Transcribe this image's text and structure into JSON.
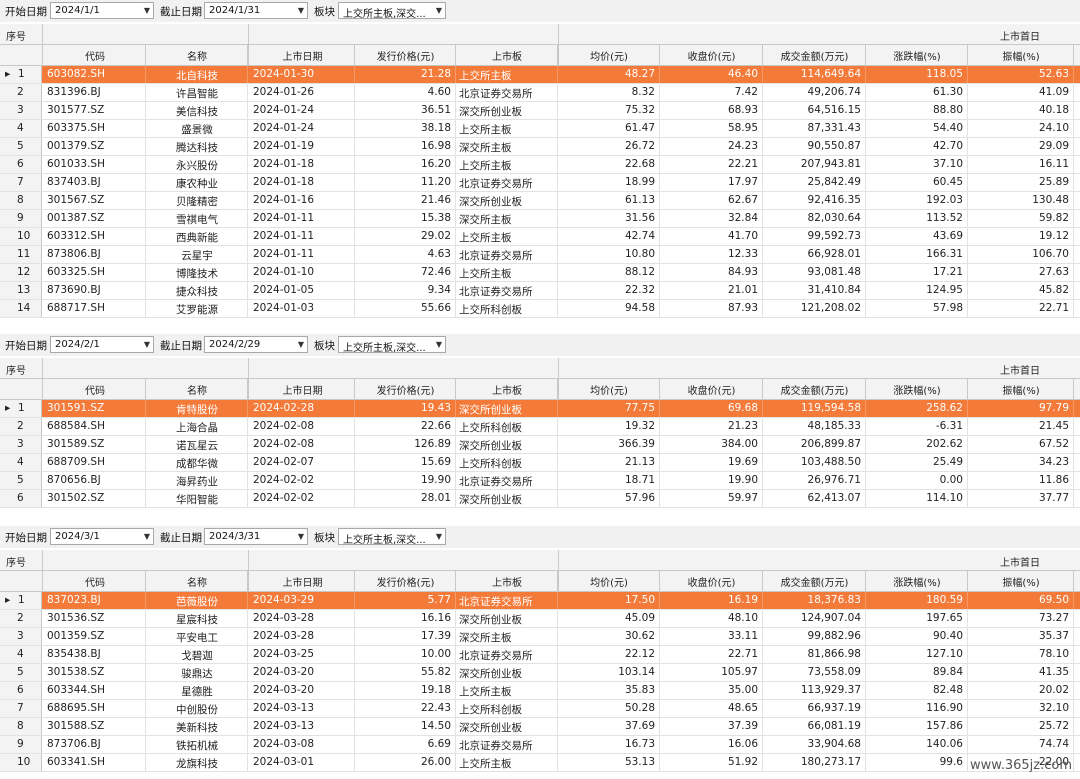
{
  "labels": {
    "start_date": "开始日期",
    "end_date": "截止日期",
    "board": "板块",
    "seq": "序号",
    "first_day": "上市首日",
    "columns": [
      "代码",
      "名称",
      "上市日期",
      "发行价格(元)",
      "上市板",
      "均价(元)",
      "收盘价(元)",
      "成交金额(万元)",
      "涨跌幅(%)",
      "振幅(%)"
    ]
  },
  "sections": [
    {
      "start": "2024/1/1",
      "end": "2024/1/31",
      "board": "上交所主板,深交...",
      "rows": [
        [
          "1",
          "603082.SH",
          "北自科技",
          "2024-01-30",
          "21.28",
          "上交所主板",
          "48.27",
          "46.40",
          "114,649.64",
          "118.05",
          "52.63"
        ],
        [
          "2",
          "831396.BJ",
          "许昌智能",
          "2024-01-26",
          "4.60",
          "北京证券交易所",
          "8.32",
          "7.42",
          "49,206.74",
          "61.30",
          "41.09"
        ],
        [
          "3",
          "301577.SZ",
          "美信科技",
          "2024-01-24",
          "36.51",
          "深交所创业板",
          "75.32",
          "68.93",
          "64,516.15",
          "88.80",
          "40.18"
        ],
        [
          "4",
          "603375.SH",
          "盛景微",
          "2024-01-24",
          "38.18",
          "上交所主板",
          "61.47",
          "58.95",
          "87,331.43",
          "54.40",
          "24.10"
        ],
        [
          "5",
          "001379.SZ",
          "腾达科技",
          "2024-01-19",
          "16.98",
          "深交所主板",
          "26.72",
          "24.23",
          "90,550.87",
          "42.70",
          "29.09"
        ],
        [
          "6",
          "601033.SH",
          "永兴股份",
          "2024-01-18",
          "16.20",
          "上交所主板",
          "22.68",
          "22.21",
          "207,943.81",
          "37.10",
          "16.11"
        ],
        [
          "7",
          "837403.BJ",
          "康农种业",
          "2024-01-18",
          "11.20",
          "北京证券交易所",
          "18.99",
          "17.97",
          "25,842.49",
          "60.45",
          "25.89"
        ],
        [
          "8",
          "301567.SZ",
          "贝隆精密",
          "2024-01-16",
          "21.46",
          "深交所创业板",
          "61.13",
          "62.67",
          "92,416.35",
          "192.03",
          "130.48"
        ],
        [
          "9",
          "001387.SZ",
          "雪祺电气",
          "2024-01-11",
          "15.38",
          "深交所主板",
          "31.56",
          "32.84",
          "82,030.64",
          "113.52",
          "59.82"
        ],
        [
          "10",
          "603312.SH",
          "西典新能",
          "2024-01-11",
          "29.02",
          "上交所主板",
          "42.74",
          "41.70",
          "99,592.73",
          "43.69",
          "19.12"
        ],
        [
          "11",
          "873806.BJ",
          "云星宇",
          "2024-01-11",
          "4.63",
          "北京证券交易所",
          "10.80",
          "12.33",
          "66,928.01",
          "166.31",
          "106.70"
        ],
        [
          "12",
          "603325.SH",
          "博隆技术",
          "2024-01-10",
          "72.46",
          "上交所主板",
          "88.12",
          "84.93",
          "93,081.48",
          "17.21",
          "27.63"
        ],
        [
          "13",
          "873690.BJ",
          "捷众科技",
          "2024-01-05",
          "9.34",
          "北京证券交易所",
          "22.32",
          "21.01",
          "31,410.84",
          "124.95",
          "45.82"
        ],
        [
          "14",
          "688717.SH",
          "艾罗能源",
          "2024-01-03",
          "55.66",
          "上交所科创板",
          "94.58",
          "87.93",
          "121,208.02",
          "57.98",
          "22.71"
        ]
      ]
    },
    {
      "start": "2024/2/1",
      "end": "2024/2/29",
      "board": "上交所主板,深交...",
      "rows": [
        [
          "1",
          "301591.SZ",
          "肯特股份",
          "2024-02-28",
          "19.43",
          "深交所创业板",
          "77.75",
          "69.68",
          "119,594.58",
          "258.62",
          "97.79"
        ],
        [
          "2",
          "688584.SH",
          "上海合晶",
          "2024-02-08",
          "22.66",
          "上交所科创板",
          "19.32",
          "21.23",
          "48,185.33",
          "-6.31",
          "21.45"
        ],
        [
          "3",
          "301589.SZ",
          "诺瓦星云",
          "2024-02-08",
          "126.89",
          "深交所创业板",
          "366.39",
          "384.00",
          "206,899.87",
          "202.62",
          "67.52"
        ],
        [
          "4",
          "688709.SH",
          "成都华微",
          "2024-02-07",
          "15.69",
          "上交所科创板",
          "21.13",
          "19.69",
          "103,488.50",
          "25.49",
          "34.23"
        ],
        [
          "5",
          "870656.BJ",
          "海昇药业",
          "2024-02-02",
          "19.90",
          "北京证券交易所",
          "18.71",
          "19.90",
          "26,976.71",
          "0.00",
          "11.86"
        ],
        [
          "6",
          "301502.SZ",
          "华阳智能",
          "2024-02-02",
          "28.01",
          "深交所创业板",
          "57.96",
          "59.97",
          "62,413.07",
          "114.10",
          "37.77"
        ]
      ]
    },
    {
      "start": "2024/3/1",
      "end": "2024/3/31",
      "board": "上交所主板,深交...",
      "rows": [
        [
          "1",
          "837023.BJ",
          "芭薇股份",
          "2024-03-29",
          "5.77",
          "北京证券交易所",
          "17.50",
          "16.19",
          "18,376.83",
          "180.59",
          "69.50"
        ],
        [
          "2",
          "301536.SZ",
          "星宸科技",
          "2024-03-28",
          "16.16",
          "深交所创业板",
          "45.09",
          "48.10",
          "124,907.04",
          "197.65",
          "73.27"
        ],
        [
          "3",
          "001359.SZ",
          "平安电工",
          "2024-03-28",
          "17.39",
          "深交所主板",
          "30.62",
          "33.11",
          "99,882.96",
          "90.40",
          "35.37"
        ],
        [
          "4",
          "835438.BJ",
          "戈碧迦",
          "2024-03-25",
          "10.00",
          "北京证券交易所",
          "22.12",
          "22.71",
          "81,866.98",
          "127.10",
          "78.10"
        ],
        [
          "5",
          "301538.SZ",
          "骏鼎达",
          "2024-03-20",
          "55.82",
          "深交所创业板",
          "103.14",
          "105.97",
          "73,558.09",
          "89.84",
          "41.35"
        ],
        [
          "6",
          "603344.SH",
          "星德胜",
          "2024-03-20",
          "19.18",
          "上交所主板",
          "35.83",
          "35.00",
          "113,929.37",
          "82.48",
          "20.02"
        ],
        [
          "7",
          "688695.SH",
          "中创股份",
          "2024-03-13",
          "22.43",
          "上交所科创板",
          "50.28",
          "48.65",
          "66,937.19",
          "116.90",
          "32.10"
        ],
        [
          "8",
          "301588.SZ",
          "美新科技",
          "2024-03-13",
          "14.50",
          "深交所创业板",
          "37.69",
          "37.39",
          "66,081.19",
          "157.86",
          "25.72"
        ],
        [
          "9",
          "873706.BJ",
          "铁拓机械",
          "2024-03-08",
          "6.69",
          "北京证券交易所",
          "16.73",
          "16.06",
          "33,904.68",
          "140.06",
          "74.74"
        ],
        [
          "10",
          "603341.SH",
          "龙旗科技",
          "2024-03-01",
          "26.00",
          "上交所主板",
          "53.13",
          "51.92",
          "180,273.17",
          "99.6",
          "22.00"
        ]
      ]
    }
  ],
  "watermark": "www.365jz.com",
  "colors": {
    "selected_row": "#f47a3a",
    "header_bg": "#f3f3f3"
  }
}
